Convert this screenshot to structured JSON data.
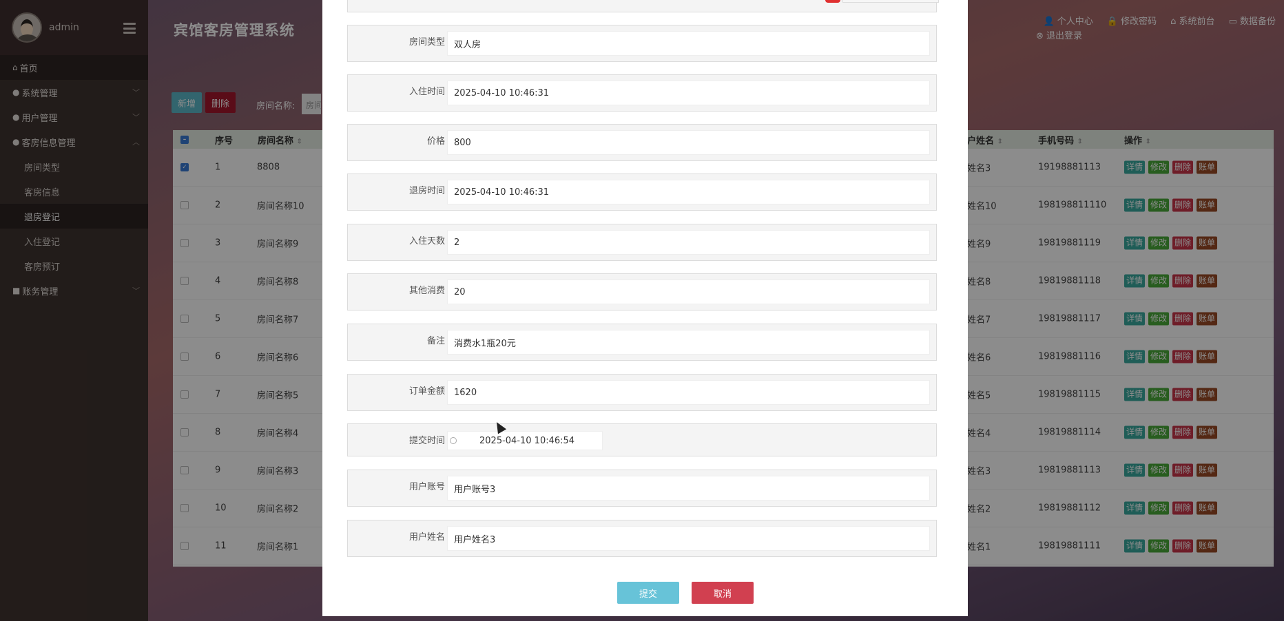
{
  "sidebar": {
    "username": "admin",
    "items": [
      {
        "label": "首页",
        "icon": "home-icon"
      },
      {
        "label": "系统管理",
        "icon": "drop-icon"
      },
      {
        "label": "用户管理",
        "icon": "user-icon"
      },
      {
        "label": "客房信息管理",
        "icon": "group-icon"
      }
    ],
    "sub_items": [
      {
        "label": "房间类型"
      },
      {
        "label": "客房信息"
      },
      {
        "label": "退房登记"
      },
      {
        "label": "入住登记"
      },
      {
        "label": "客房预订"
      }
    ],
    "finance": {
      "label": "账务管理"
    }
  },
  "header": {
    "title": "宾馆客房管理系统",
    "links": [
      "个人中心",
      "修改密码",
      "系统前台",
      "数据备份",
      "退出登录"
    ]
  },
  "toolbar": {
    "add_label": "新增",
    "delete_label": "删除",
    "search_label": "房间名称:",
    "search_placeholder": "房间名称"
  },
  "table": {
    "headers": [
      "序号",
      "房间名称",
      "户姓名",
      "手机号码",
      "操作"
    ],
    "op_labels": [
      "详情",
      "修改",
      "删除",
      "账单"
    ],
    "rows": [
      {
        "no": "1",
        "name": "8808",
        "user": "姓名3",
        "phone": "19198881113"
      },
      {
        "no": "2",
        "name": "房间名称10",
        "user": "姓名10",
        "phone": "198198811110"
      },
      {
        "no": "3",
        "name": "房间名称9",
        "user": "姓名9",
        "phone": "19819881119"
      },
      {
        "no": "4",
        "name": "房间名称8",
        "user": "姓名8",
        "phone": "19819881118"
      },
      {
        "no": "5",
        "name": "房间名称7",
        "user": "姓名7",
        "phone": "19819881117"
      },
      {
        "no": "6",
        "name": "房间名称6",
        "user": "姓名6",
        "phone": "19819881116"
      },
      {
        "no": "7",
        "name": "房间名称5",
        "user": "姓名5",
        "phone": "19819881115"
      },
      {
        "no": "8",
        "name": "房间名称4",
        "user": "姓名4",
        "phone": "19819881114"
      },
      {
        "no": "9",
        "name": "房间名称3",
        "user": "姓名3",
        "phone": "19819881113"
      },
      {
        "no": "10",
        "name": "房间名称2",
        "user": "姓名2",
        "phone": "19819881112"
      },
      {
        "no": "11",
        "name": "房间名称1",
        "user": "姓名1",
        "phone": "19819881111"
      }
    ]
  },
  "modal": {
    "fields": [
      {
        "label": "房间类型",
        "value": "双人房"
      },
      {
        "label": "入住时间",
        "value": "2025-04-10 10:46:31"
      },
      {
        "label": "价格",
        "value": "800"
      },
      {
        "label": "退房时间",
        "value": "2025-04-10 10:46:31"
      },
      {
        "label": "入住天数",
        "value": "2"
      },
      {
        "label": "其他消费",
        "value": "20"
      },
      {
        "label": "备注",
        "value": "消费水1瓶20元"
      },
      {
        "label": "订单金额",
        "value": "1620"
      },
      {
        "label": "提交时间",
        "value": "2025-04-10 10:46:54"
      },
      {
        "label": "用户账号",
        "value": "用户账号3"
      },
      {
        "label": "用户姓名",
        "value": "用户姓名3"
      }
    ],
    "submit_label": "提交",
    "cancel_label": "取消"
  }
}
